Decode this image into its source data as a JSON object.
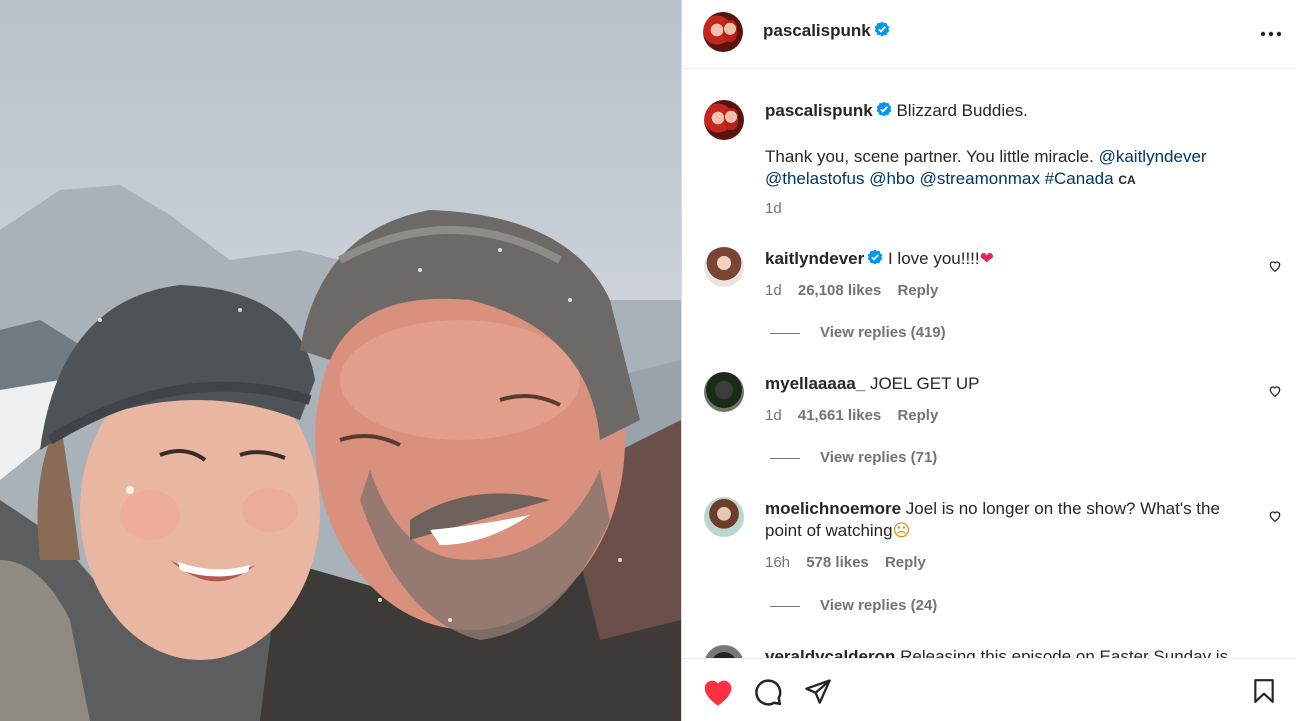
{
  "post": {
    "author": "pascalispunk",
    "caption_title": "Blizzard Buddies.",
    "caption_body": "Thank you, scene partner. You little miracle.",
    "mentions": [
      "@kaitlyndever",
      "@thelastofus",
      "@hbo",
      "@streamonmax",
      "#Canada"
    ],
    "country_tag": "CA",
    "time": "1d"
  },
  "comments": [
    {
      "user": "kaitlyndever",
      "verified": true,
      "text": "I love you!!!!",
      "emoji": "❤",
      "time": "1d",
      "likes": "26,108 likes",
      "reply": "Reply",
      "view_replies": "View replies (419)"
    },
    {
      "user": "myellaaaaa_",
      "verified": false,
      "text": "JOEL GET UP",
      "time": "1d",
      "likes": "41,661 likes",
      "reply": "Reply",
      "view_replies": "View replies (71)"
    },
    {
      "user": "moelichnoemore",
      "verified": false,
      "text": "Joel is no longer on the show? What's the point of watching",
      "emoji": "☹",
      "time": "16h",
      "likes": "578 likes",
      "reply": "Reply",
      "view_replies": "View replies (24)"
    },
    {
      "user": "veraldycalderon",
      "verified": false,
      "text": "Releasing this episode on Easter Sunday is"
    }
  ],
  "icons": {
    "verified": "verified-badge-icon",
    "more": "more-options-icon",
    "like": "heart-icon",
    "comment": "comment-icon",
    "share": "share-icon",
    "save": "bookmark-icon"
  },
  "colors": {
    "verified": "#0095f6",
    "like_active": "#ff3040",
    "link": "#00376b",
    "secondary_text": "#737373"
  }
}
